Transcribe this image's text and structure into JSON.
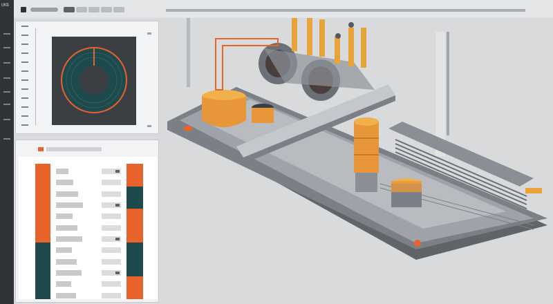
{
  "app": {
    "rail_logo": "UKB",
    "tabs": [
      "",
      "",
      "",
      "",
      ""
    ]
  },
  "colors": {
    "accent_orange": "#e8632a",
    "teal": "#1e4a4e",
    "amber": "#f0a83c",
    "dark_panel": "#3b3e42",
    "machine_gray": "#8a8f95"
  },
  "chart_data": {
    "type": "bar",
    "categories": [
      "",
      "",
      "",
      "",
      "",
      "",
      "",
      "",
      "",
      "",
      "",
      ""
    ],
    "series": [
      {
        "values": [
          1,
          1,
          1,
          1,
          1,
          1,
          1,
          1,
          1,
          1,
          1,
          1
        ]
      },
      {
        "values": [
          1,
          1,
          1,
          1,
          1,
          1,
          1,
          1,
          1,
          1,
          1,
          1
        ]
      }
    ]
  },
  "scope": {
    "type": "donut",
    "ring_fraction": 1
  }
}
